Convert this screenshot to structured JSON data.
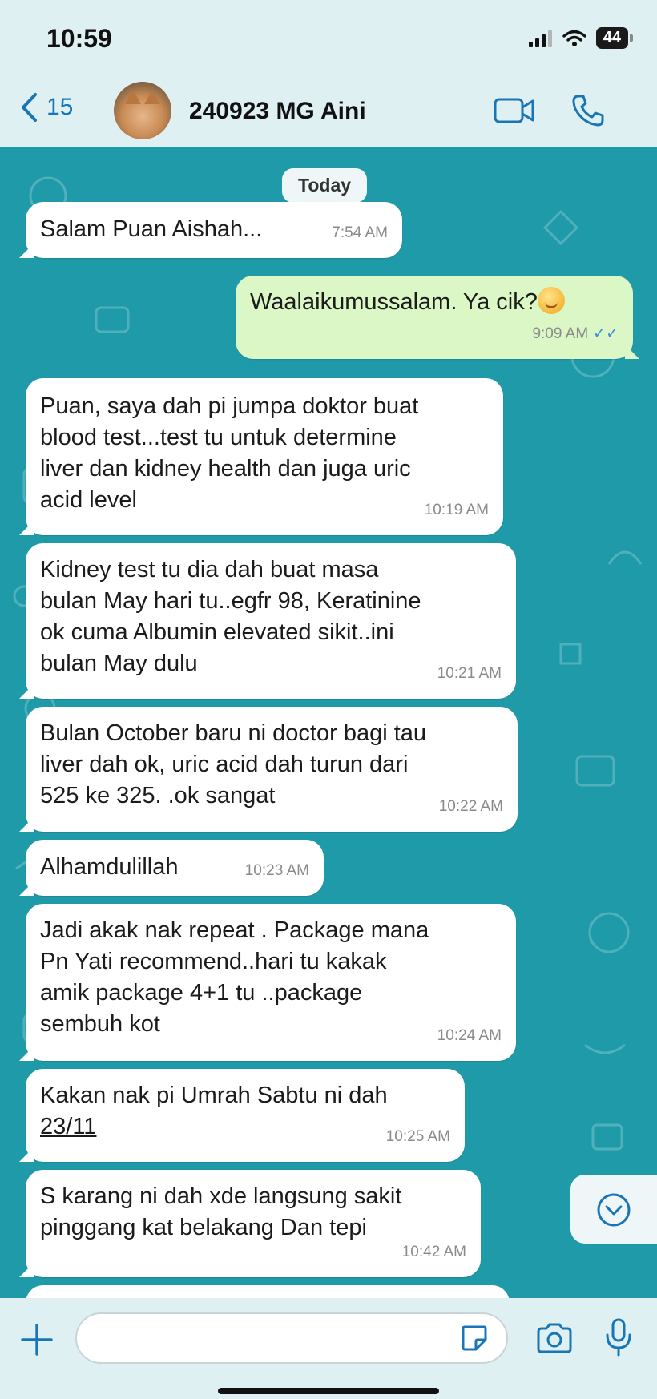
{
  "status_bar": {
    "time": "10:59",
    "battery": "44"
  },
  "header": {
    "back_count": "15",
    "contact_name": "240923 MG Aini"
  },
  "chat": {
    "day_label": "Today",
    "messages": [
      {
        "direction": "in",
        "text": "Salam Puan Aishah...",
        "time": "7:54 AM"
      },
      {
        "direction": "out",
        "text": "Waalaikumussalam. Ya cik?",
        "time": "9:09 AM",
        "read": true
      },
      {
        "direction": "in",
        "text": "Puan, saya dah pi jumpa doktor buat\nblood test...test tu untuk determine\nliver dan kidney health dan juga uric\nacid level",
        "time": "10:19 AM"
      },
      {
        "direction": "in",
        "text": "Kidney test tu dia dah buat masa\nbulan  May hari tu..egfr 98, Keratinine\nok cuma Albumin elevated sikit..ini\nbulan May dulu",
        "time": "10:21 AM"
      },
      {
        "direction": "in",
        "text": "Bulan October baru ni doctor bagi tau\nliver dah ok, uric acid dah turun dari\n525 ke 325.  .ok sangat",
        "time": "10:22 AM"
      },
      {
        "direction": "in",
        "text": "Alhamdulillah",
        "time": "10:23 AM"
      },
      {
        "direction": "in",
        "text": "Jadi akak nak repeat . Package mana\nPn Yati recommend..hari tu kakak\namik package 4+1 tu ..package\nsembuh kot",
        "time": "10:24 AM"
      },
      {
        "direction": "in",
        "text": "Kakan nak pi Umrah Sabtu ni dah",
        "text_date": "23/11",
        "time": "10:25 AM"
      },
      {
        "direction": "in",
        "text": "S karang ni dah xde langsung sakit\npinggang kat belakang Dan tepi",
        "time": "10:42 AM"
      }
    ]
  },
  "composer": {
    "placeholder": ""
  },
  "icons": {
    "back": "chevron-left-icon",
    "video": "video-camera-icon",
    "call": "phone-icon",
    "scroll": "chevron-down-circle-icon",
    "plus": "plus-icon",
    "sticker": "sticker-icon",
    "camera": "camera-icon",
    "mic": "microphone-icon"
  },
  "colors": {
    "wallpaper": "#1f9aa8",
    "header_bg": "#dff0f3",
    "incoming_bubble": "#ffffff",
    "outgoing_bubble": "#dbf7c6",
    "accent": "#1876b6"
  }
}
